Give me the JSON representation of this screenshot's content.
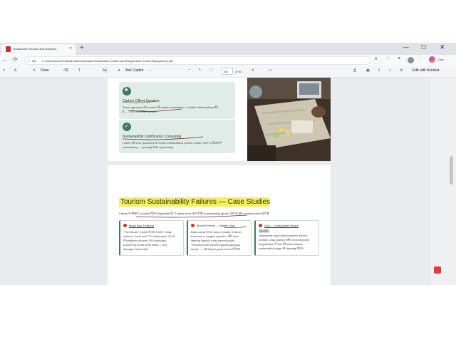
{
  "browser": {
    "tab_title": "Sustainable-Tourism-and-Respons",
    "address_prefix": "File",
    "url": "C:/Users/Komal%20kathoria/Downloads/Sustainable-Tourism-and-Responsible-Travel-Management.pdf",
    "chat_label": "Chat"
  },
  "pdf_toolbar": {
    "draw_label": "Draw",
    "ask_copilot_label": "Ask Copilot",
    "page_current": "56",
    "page_total": "of 60",
    "edit_acrobat_label": "Edit with Acrobat"
  },
  "page1": {
    "card1": {
      "title": "Carbon Offset Services",
      "body_line1": "Travel agencies जो tourists को carbon calculation + verified offset options देते",
      "body_line2": "हैं — ये एक नया पेशेवर service"
    },
    "card2": {
      "title": "Sustainability Certification Consulting",
      "body_line1": "Hotels और tour operators को Green certifications (Green Globe, GSTC) दिलाने में",
      "body_line2": "consultancy — growing B2B opportunity"
    }
  },
  "page2": {
    "heading": "Tourism Sustainability Failures — Case Studies",
    "intro": "Failure से सीखना success जितना important है। ये cases show करते हैं कि sustainability ignore करने के क्या consequences होते हैं।",
    "cases": [
      {
        "title": "Maya Bay, Thailand",
        "lines": [
          "\"The Beach\" movie के बाद 5,000+ daily",
          "visitors। Coral reef 77% destroyed। 2018",
          "में indefinite closure। अब controlled",
          "reopening under strict limits — but",
          "damage irreversible."
        ]
      },
      {
        "title": "Mount Everest — Waste Crisis",
        "lines": [
          "Base camp पर 50 tons of waste। Human",
          "excrement, oxygen cylinders और tents",
          "littering Nepal's most sacred peak।",
          "\"Everest is the world's highest garbage",
          "dump\" — अब Nepal government ने नियम"
        ]
      },
      {
        "title": "Goa — Unregulated Beach",
        "title2": "Tourism",
        "lines": [
          "Unplanned resort development, beach",
          "erosion, drug tourism और environmental",
          "degradation ने Goa की international",
          "sustainable image को damage किया।"
        ]
      }
    ]
  }
}
